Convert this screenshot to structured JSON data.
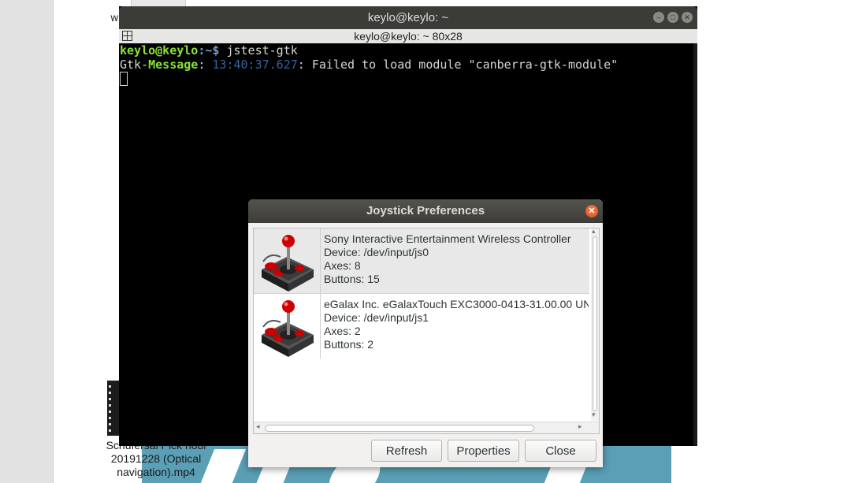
{
  "desktop": {
    "stray_text": "w",
    "file_label": "Schufersal Pick noui 20191228 (Optical navigation).mp4"
  },
  "terminal": {
    "title": "keylo@keylo: ~",
    "subtitle": "keylo@keylo: ~ 80x28",
    "prompt_user": "keylo@keylo",
    "prompt_path": ":~$ ",
    "command": "jstest-gtk",
    "msg_prefix": "Gtk-",
    "msg_tag": "Message",
    "msg_sep": ": ",
    "msg_time": "13:40:37.627",
    "msg_text": ": Failed to load module \"canberra-gtk-module\""
  },
  "dialog": {
    "title": "Joystick Preferences",
    "devices": [
      {
        "name": "Sony Interactive Entertainment Wireless Controller",
        "device": "Device: /dev/input/js0",
        "axes": "Axes: 8",
        "buttons": "Buttons: 15"
      },
      {
        "name": "eGalax Inc. eGalaxTouch EXC3000-0413-31.00.00 UN",
        "device": "Device: /dev/input/js1",
        "axes": "Axes: 2",
        "buttons": "Buttons: 2"
      }
    ],
    "buttons": {
      "refresh": "Refresh",
      "properties": "Properties",
      "close": "Close"
    }
  },
  "colors": {
    "prompt_green": "#8ae234",
    "prompt_blue": "#729fcf",
    "timestamp_blue": "#3465a4",
    "close_orange": "#e3622a",
    "joystick_red": "#cc0000"
  },
  "icons": {
    "device_icon": "joystick-icon",
    "dialog_close": "close-icon",
    "terminal_menu": "terminal-menu-icon"
  }
}
